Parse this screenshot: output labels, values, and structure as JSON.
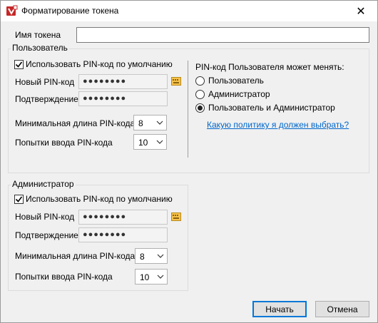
{
  "window": {
    "title": "Форматирование токена",
    "close_glyph": "✕"
  },
  "token_name": {
    "label": "Имя токена",
    "value": ""
  },
  "user": {
    "legend": "Пользователь",
    "use_default_label": "Использовать PIN-код по умолчанию",
    "use_default_checked": true,
    "new_pin_label": "Новый PIN-код",
    "new_pin_value": "●●●●●●●●",
    "confirm_label": "Подтверждение",
    "confirm_value": "●●●●●●●●",
    "min_len_label": "Минимальная длина PIN-кода",
    "min_len_value": "8",
    "attempts_label": "Попытки ввода PIN-кода",
    "attempts_value": "10"
  },
  "policy": {
    "heading": "PIN-код Пользователя может менять:",
    "options": [
      {
        "label": "Пользователь",
        "selected": false
      },
      {
        "label": "Администратор",
        "selected": false
      },
      {
        "label": "Пользователь и Администратор",
        "selected": true
      }
    ],
    "link": "Какую политику я должен выбрать?"
  },
  "admin": {
    "legend": "Администратор",
    "use_default_label": "Использовать PIN-код по умолчанию",
    "use_default_checked": true,
    "new_pin_label": "Новый PIN-код",
    "new_pin_value": "●●●●●●●●",
    "confirm_label": "Подтверждение",
    "confirm_value": "●●●●●●●●",
    "min_len_label": "Минимальная длина PIN-кода",
    "min_len_value": "8",
    "attempts_label": "Попытки ввода PIN-кода",
    "attempts_value": "10"
  },
  "buttons": {
    "start": "Начать",
    "cancel": "Отмена"
  },
  "icons": {
    "app": "token-format-app-icon",
    "keyboard": "virtual-keyboard-icon",
    "chevron": "chevron-down-icon"
  }
}
